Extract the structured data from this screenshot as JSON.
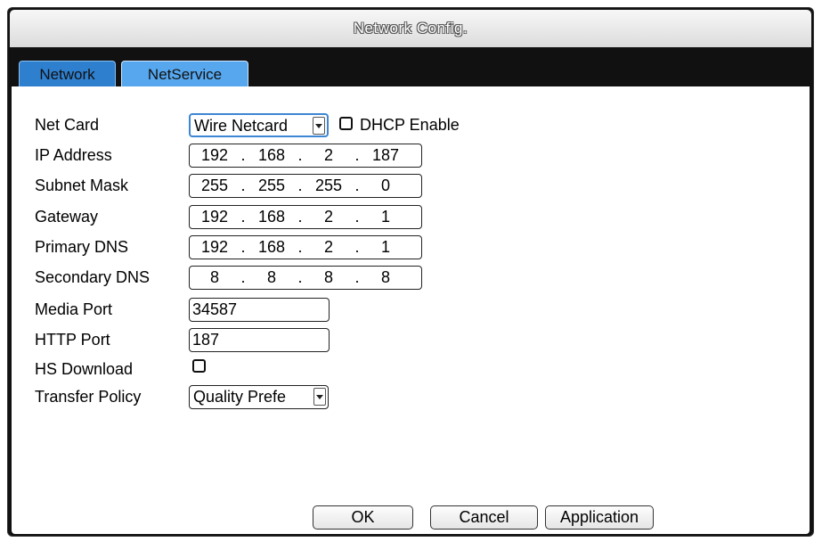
{
  "window": {
    "title": "Network Config."
  },
  "tabs": [
    {
      "label": "Network"
    },
    {
      "label": "NetService"
    }
  ],
  "form": {
    "net_card": {
      "label": "Net Card",
      "value": "Wire Netcard"
    },
    "dhcp": {
      "label": "DHCP Enable",
      "checked": false
    },
    "ip_address": {
      "label": "IP Address",
      "octets": [
        "192",
        "168",
        "2",
        "187"
      ]
    },
    "subnet_mask": {
      "label": "Subnet Mask",
      "octets": [
        "255",
        "255",
        "255",
        "0"
      ]
    },
    "gateway": {
      "label": "Gateway",
      "octets": [
        "192",
        "168",
        "2",
        "1"
      ]
    },
    "primary_dns": {
      "label": "Primary DNS",
      "octets": [
        "192",
        "168",
        "2",
        "1"
      ]
    },
    "secondary_dns": {
      "label": "Secondary DNS",
      "octets": [
        "8",
        "8",
        "8",
        "8"
      ]
    },
    "media_port": {
      "label": "Media Port",
      "value": "34587"
    },
    "http_port": {
      "label": "HTTP Port",
      "value": "187"
    },
    "hs_download": {
      "label": "HS Download",
      "checked": false
    },
    "transfer_policy": {
      "label": "Transfer Policy",
      "value": "Quality Prefe"
    }
  },
  "buttons": {
    "ok": "OK",
    "cancel": "Cancel",
    "application": "Application"
  },
  "icons": {
    "dropdown": "chevron-down-icon",
    "checkbox": "checkbox-icon"
  },
  "colors": {
    "tab_active": "#2f7fcf",
    "tab_inactive": "#56a7ee",
    "window_bg": "#111111"
  }
}
